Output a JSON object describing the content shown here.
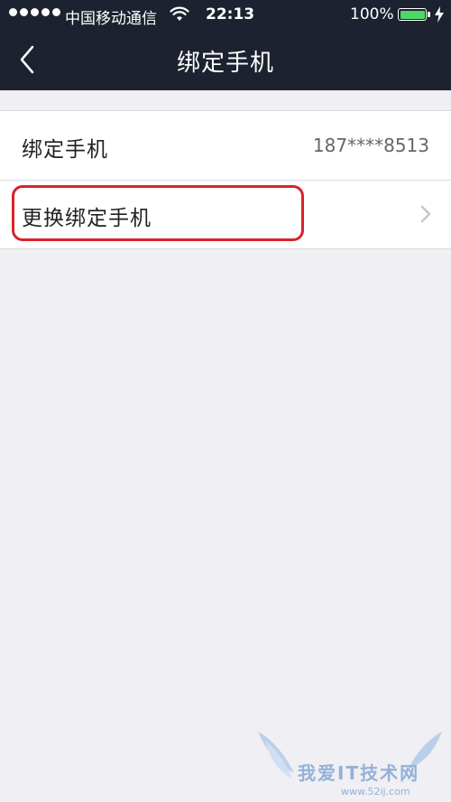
{
  "status_bar": {
    "carrier": "中国移动通信",
    "time": "22:13",
    "battery_percent": "100%",
    "battery_level": 1.0,
    "battery_color": "#4cd964",
    "wifi_icon": "wifi-icon",
    "charging_icon": "bolt-icon"
  },
  "nav": {
    "title": "绑定手机",
    "back_icon": "chevron-left-icon"
  },
  "settings": {
    "rows": [
      {
        "label": "绑定手机",
        "value": "187****8513"
      },
      {
        "label": "更换绑定手机",
        "icon": "chevron-right-icon"
      }
    ]
  },
  "annotation": {
    "highlight_color": "#d8232a"
  },
  "watermark": {
    "text": "我爱IT技术网",
    "url": "www.52ij.com"
  },
  "colors": {
    "header_bg": "#1d2230",
    "page_bg": "#efeff4"
  }
}
